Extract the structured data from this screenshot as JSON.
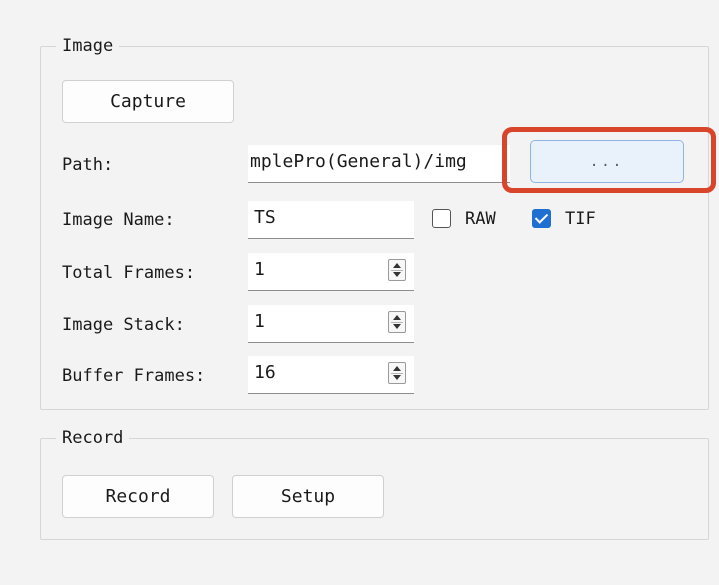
{
  "image_group": {
    "title": "Image",
    "capture_label": "Capture",
    "path_label": "Path:",
    "path_value": "mplePro(General)/img",
    "browse_label": "...",
    "image_name_label": "Image Name:",
    "image_name_value": "TS",
    "raw_label": "RAW",
    "raw_checked": false,
    "tif_label": "TIF",
    "tif_checked": true,
    "total_frames_label": "Total Frames:",
    "total_frames_value": "1",
    "image_stack_label": "Image Stack:",
    "image_stack_value": "1",
    "buffer_frames_label": "Buffer Frames:",
    "buffer_frames_value": "16"
  },
  "record_group": {
    "title": "Record",
    "record_label": "Record",
    "setup_label": "Setup"
  },
  "colors": {
    "highlight": "#d9452a",
    "checkbox_checked": "#1e6fd1",
    "background": "#f3f3f3"
  }
}
